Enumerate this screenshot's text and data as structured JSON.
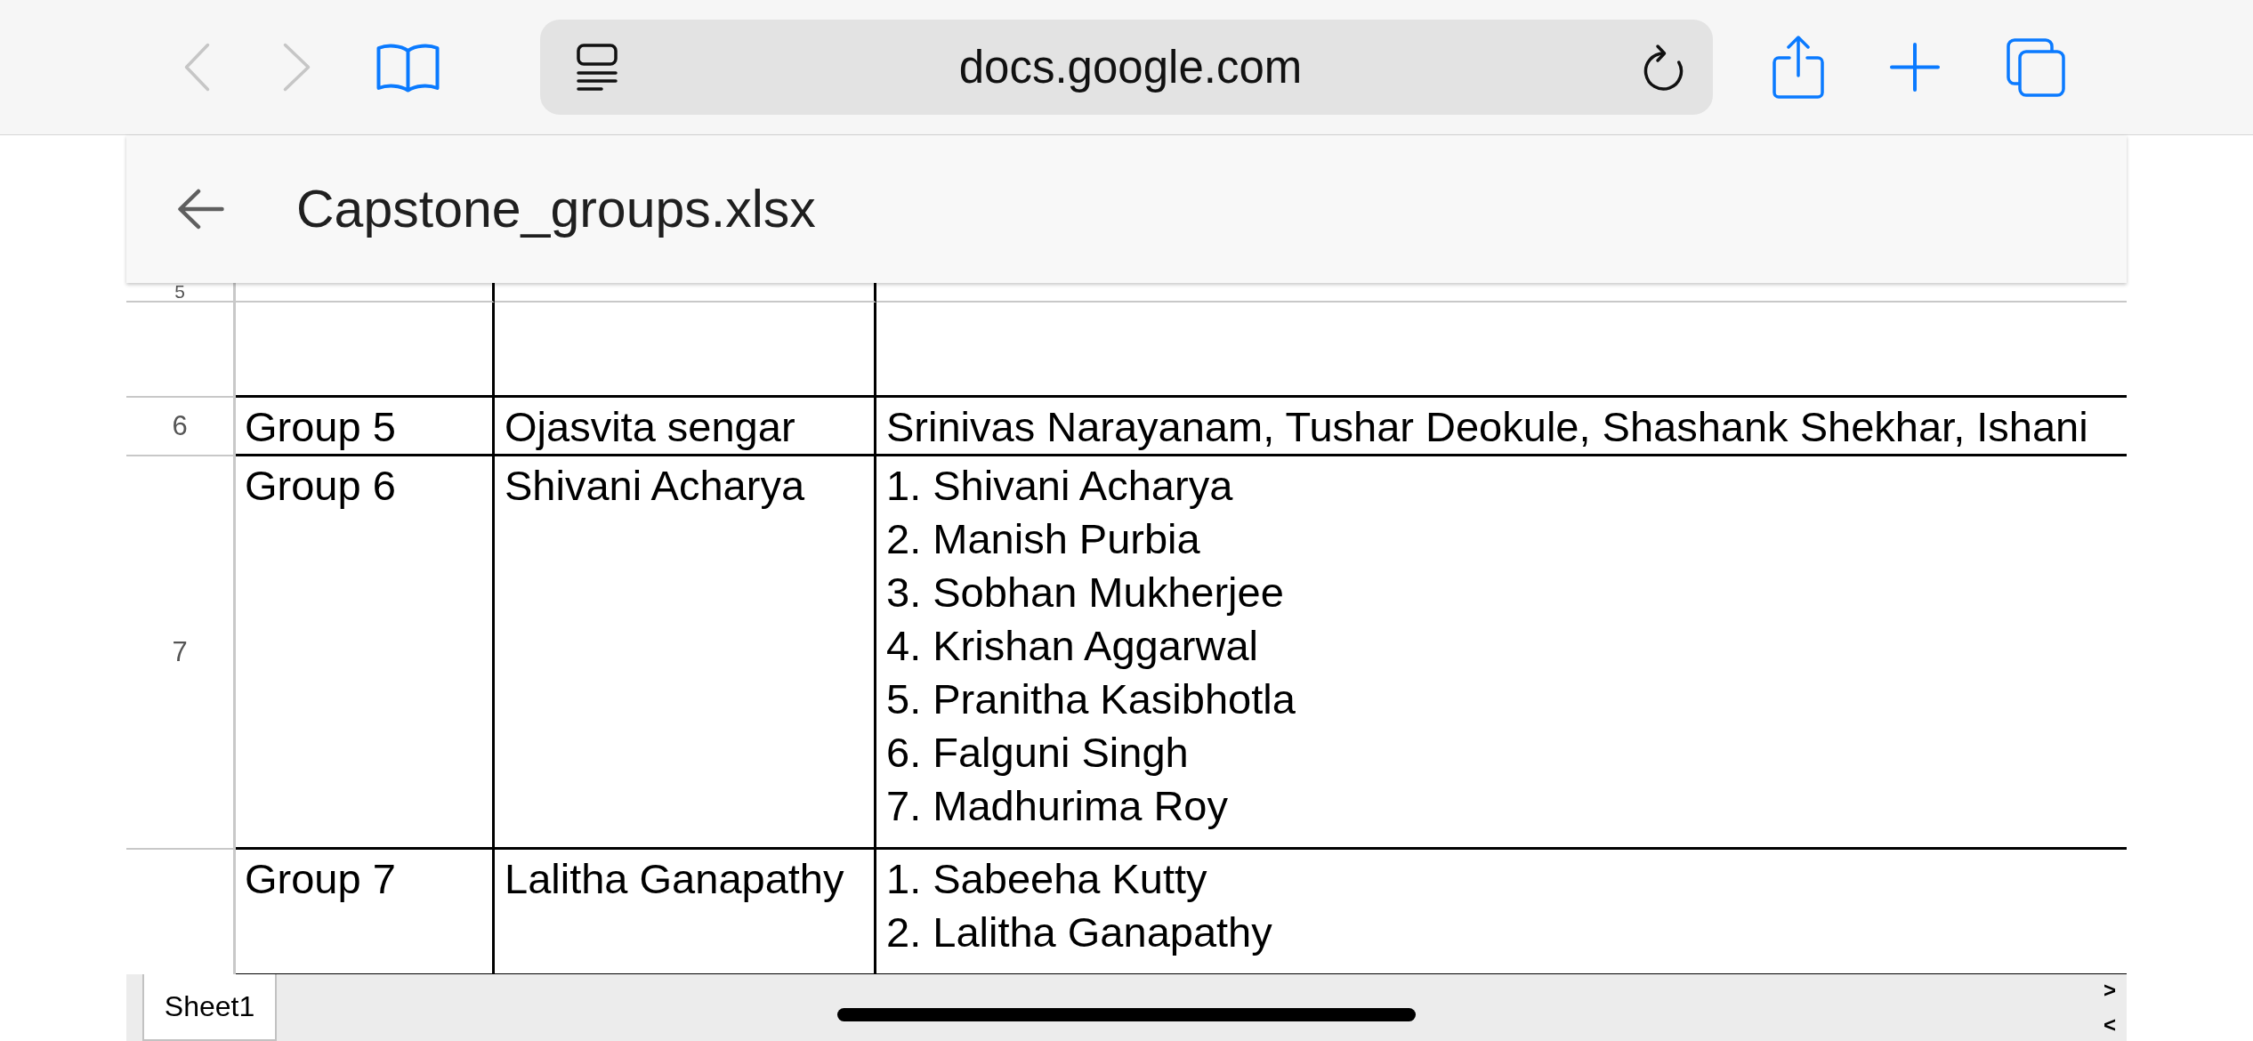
{
  "browser": {
    "left_buttons": [
      {
        "kind": "back",
        "disabled": true
      },
      {
        "kind": "forward",
        "disabled": true
      },
      {
        "kind": "bookmarks",
        "disabled": false
      }
    ],
    "address": {
      "url": "docs.google.com"
    },
    "right_buttons": [
      {
        "kind": "share",
        "disabled": false
      },
      {
        "kind": "new_tab",
        "disabled": false
      },
      {
        "kind": "tabs",
        "disabled": false
      }
    ]
  },
  "document": {
    "title": "Capstone_groups.xlsx"
  },
  "sheet": {
    "rows": [
      {
        "kind": "cut",
        "number": "5"
      },
      {
        "kind": "blank"
      },
      {
        "kind": "single",
        "number": "6",
        "cells": [
          {
            "kind": "text",
            "text": "Group 5"
          },
          {
            "kind": "text",
            "text": "Ojasvita sengar"
          },
          {
            "kind": "text",
            "text": "Srinivas Narayanam, Tushar Deokule, Shashank Shekhar, Ishani"
          }
        ]
      },
      {
        "kind": "multi",
        "number": "7",
        "cells": [
          {
            "kind": "text",
            "text": "Group 6"
          },
          {
            "kind": "text",
            "text": "Shivani Acharya"
          },
          {
            "kind": "list",
            "lines": [
              "1. Shivani Acharya",
              "2. Manish Purbia",
              "3. Sobhan Mukherjee",
              "4. Krishan Aggarwal",
              "5. Pranitha Kasibhotla",
              "6. Falguni Singh",
              "7. Madhurima Roy"
            ]
          }
        ]
      },
      {
        "kind": "multi",
        "cells": [
          {
            "kind": "text",
            "text": "Group 7"
          },
          {
            "kind": "text",
            "text": "Lalitha Ganapathy"
          },
          {
            "kind": "list",
            "lines": [
              "1. Sabeeha Kutty",
              "2. Lalitha Ganapathy"
            ]
          }
        ]
      }
    ]
  },
  "sheet_bar": {
    "tabs": [
      {
        "label": "Sheet1",
        "selected": true
      }
    ],
    "scroll_buttons": [
      {
        "label": ">"
      },
      {
        "label": "<"
      }
    ]
  }
}
